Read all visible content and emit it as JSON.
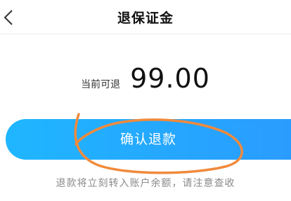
{
  "header": {
    "title": "退保证金",
    "back_icon": "chevron-left-icon"
  },
  "amount": {
    "label": "当前可退",
    "value": "99.00"
  },
  "confirm_button": {
    "label": "确认退款",
    "color_start": "#1fb6ff",
    "color_end": "#2a9cff"
  },
  "notice": {
    "text": "退款将立刻转入账户余额，请注意查收"
  },
  "annotation_color": "#f08a3c"
}
